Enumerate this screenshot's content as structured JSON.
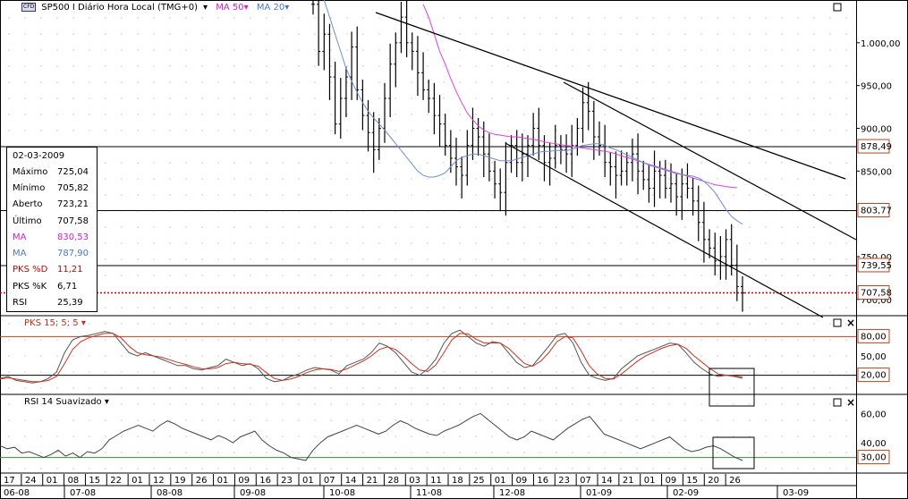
{
  "header": {
    "symbol_badge": "CFD",
    "symbol": "SP500 I Diário Hora Local (TMG+0)",
    "ma50_label": "MA 50",
    "ma20_label": "MA 20"
  },
  "colors": {
    "ma50": "#e040e0",
    "ma20": "#6b8fd8",
    "pks_d": "#d03020",
    "pks_k": "#555555",
    "rsi": "#444444",
    "rsi_ref": "#2a9a2a",
    "level_box": "#c04020",
    "dotted": "#cc0000"
  },
  "info": {
    "date": "02-03-2009",
    "rows": [
      {
        "k": "Máximo",
        "v": "725,04",
        "c": "#000000"
      },
      {
        "k": "Mínimo",
        "v": "705,82",
        "c": "#000000"
      },
      {
        "k": "Aberto",
        "v": "723,21",
        "c": "#000000"
      },
      {
        "k": "Último",
        "v": "707,58",
        "c": "#000000"
      },
      {
        "k": "MA",
        "v": "830,53",
        "c": "#d020d0"
      },
      {
        "k": "MA",
        "v": "787,90",
        "c": "#4a78c8"
      },
      {
        "k": "PKS %D",
        "v": "11,21",
        "c": "#cc0000"
      },
      {
        "k": "PKS %K",
        "v": "6,71",
        "c": "#000000"
      },
      {
        "k": "RSI",
        "v": "25,39",
        "c": "#000000"
      }
    ]
  },
  "panels": {
    "stoch_label": "PKS 15; 5; 5",
    "rsi_label": "RSI 14 Suavizado"
  },
  "chart_data": [
    {
      "type": "line",
      "name": "price",
      "y_axis_ticks": [
        "1.000,00",
        "950,00",
        "900,00",
        "850,00",
        "750,00",
        "700,00"
      ],
      "ylim": [
        682,
        1050
      ],
      "boxed_levels": [
        "878,49",
        "803,77",
        "739,55",
        "707,58"
      ],
      "close": [
        1045,
        990,
        1010,
        960,
        905,
        935,
        960,
        995,
        945,
        915,
        895,
        875,
        900,
        935,
        975,
        1000,
        1030,
        1000,
        990,
        965,
        945,
        935,
        915,
        905,
        880,
        865,
        855,
        845,
        880,
        900,
        890,
        870,
        850,
        835,
        825,
        860,
        880,
        860,
        870,
        880,
        900,
        880,
        860,
        865,
        880,
        875,
        870,
        880,
        900,
        930,
        920,
        890,
        880,
        860,
        855,
        845,
        850,
        860,
        870,
        850,
        840,
        830,
        850,
        845,
        830,
        835,
        820,
        835,
        830,
        815,
        790,
        770,
        760,
        745,
        750,
        770,
        740,
        715,
        707.58
      ],
      "ma50": [
        null,
        null,
        null,
        null,
        null,
        null,
        null,
        null,
        null,
        null,
        null,
        null,
        null,
        null,
        null,
        null,
        null,
        null,
        null,
        null,
        1045,
        1030,
        1010,
        990,
        975,
        958,
        943,
        930,
        918,
        910,
        903,
        898,
        895,
        893,
        892,
        891,
        890,
        890,
        889,
        888,
        887,
        886,
        884,
        883,
        882,
        881,
        880,
        879,
        878,
        877,
        876,
        875,
        874,
        873,
        872,
        870,
        868,
        866,
        864,
        862,
        860,
        858,
        856,
        854,
        852,
        850,
        848,
        846,
        844,
        842,
        840,
        838,
        836,
        834,
        833,
        832,
        831,
        830.53,
        null
      ],
      "ma20": [
        1100,
        1075,
        1050,
        1030,
        1010,
        990,
        970,
        955,
        942,
        930,
        920,
        912,
        905,
        898,
        890,
        882,
        874,
        866,
        858,
        850,
        845,
        843,
        843,
        845,
        848,
        855,
        862,
        866,
        868,
        870,
        870,
        868,
        866,
        864,
        862,
        862,
        862,
        864,
        866,
        868,
        870,
        872,
        873,
        873,
        874,
        874,
        874,
        875,
        878,
        880,
        881,
        882,
        882,
        880,
        877,
        875,
        872,
        869,
        866,
        863,
        860,
        857,
        855,
        853,
        851,
        849,
        847,
        846,
        845,
        844,
        842,
        838,
        832,
        825,
        815,
        805,
        797,
        792,
        787.9
      ],
      "trendlines_desc": "three descending lines from upper-left forming a falling wedge; lower channel line from ~12-08 to beyond 02-09"
    },
    {
      "type": "line",
      "name": "stochastic",
      "title": "PKS 15; 5; 5",
      "y_axis_ticks": [
        "50,00"
      ],
      "boxed_levels": [
        "80,00",
        "20,00"
      ],
      "ylim": [
        0,
        100
      ],
      "k": [
        15,
        18,
        12,
        10,
        8,
        10,
        15,
        25,
        55,
        75,
        80,
        82,
        85,
        88,
        85,
        70,
        55,
        50,
        55,
        50,
        45,
        40,
        35,
        35,
        30,
        28,
        32,
        35,
        45,
        40,
        35,
        38,
        30,
        15,
        10,
        12,
        18,
        22,
        28,
        32,
        30,
        28,
        22,
        35,
        40,
        45,
        55,
        70,
        65,
        55,
        40,
        25,
        20,
        30,
        45,
        70,
        85,
        90,
        80,
        70,
        65,
        72,
        70,
        55,
        40,
        32,
        35,
        50,
        65,
        82,
        85,
        70,
        40,
        20,
        15,
        12,
        15,
        30,
        40,
        50,
        55,
        60,
        65,
        70,
        68,
        55,
        40,
        30,
        22,
        18,
        20,
        18,
        15
      ],
      "d": [
        14,
        16,
        14,
        12,
        10,
        10,
        12,
        18,
        38,
        60,
        72,
        78,
        82,
        85,
        85,
        78,
        65,
        55,
        52,
        50,
        48,
        44,
        40,
        37,
        33,
        30,
        30,
        32,
        38,
        40,
        38,
        37,
        34,
        24,
        15,
        12,
        14,
        18,
        24,
        28,
        30,
        29,
        26,
        30,
        36,
        42,
        50,
        60,
        64,
        60,
        50,
        38,
        28,
        26,
        36,
        55,
        75,
        85,
        84,
        76,
        70,
        70,
        70,
        62,
        50,
        38,
        34,
        42,
        55,
        72,
        80,
        78,
        58,
        35,
        22,
        15,
        14,
        22,
        32,
        42,
        50,
        56,
        62,
        66,
        68,
        62,
        50,
        40,
        30,
        22,
        20,
        19,
        17
      ]
    },
    {
      "type": "line",
      "name": "rsi",
      "title": "RSI 14 Suavizado",
      "y_axis_ticks": [
        "60,00",
        "40,00"
      ],
      "boxed_levels": [
        "30,00"
      ],
      "ylim": [
        20,
        70
      ],
      "values": [
        38,
        36,
        37,
        33,
        34,
        32,
        30,
        32,
        35,
        31,
        33,
        30,
        34,
        33,
        36,
        42,
        45,
        48,
        50,
        52,
        50,
        48,
        52,
        55,
        53,
        50,
        48,
        46,
        44,
        42,
        45,
        43,
        40,
        44,
        46,
        48,
        42,
        38,
        35,
        33,
        30,
        29,
        28,
        35,
        40,
        44,
        46,
        48,
        50,
        52,
        50,
        48,
        46,
        48,
        52,
        55,
        53,
        50,
        48,
        46,
        45,
        48,
        50,
        52,
        55,
        58,
        60,
        56,
        52,
        48,
        44,
        42,
        44,
        48,
        46,
        44,
        42,
        46,
        50,
        53,
        56,
        58,
        52,
        46,
        44,
        42,
        40,
        38,
        36,
        38,
        40,
        42,
        44,
        40,
        36,
        34,
        35,
        37,
        38,
        36,
        33,
        30,
        28
      ]
    }
  ],
  "x_axis": {
    "days": [
      "17",
      "24",
      "01",
      "08",
      "15",
      "22",
      "01",
      "12",
      "19",
      "26",
      "01",
      "09",
      "16",
      "23",
      "01",
      "07",
      "14",
      "21",
      "28",
      "03",
      "11",
      "18",
      "25",
      "01",
      "09",
      "16",
      "23",
      "07",
      "14",
      "21",
      "01",
      "09",
      "15",
      "20",
      "26"
    ],
    "months": [
      "06-08",
      "07-08",
      "08-08",
      "09-08",
      "10-08",
      "11-08",
      "12-08",
      "01-09",
      "02-09",
      "03-09"
    ]
  }
}
